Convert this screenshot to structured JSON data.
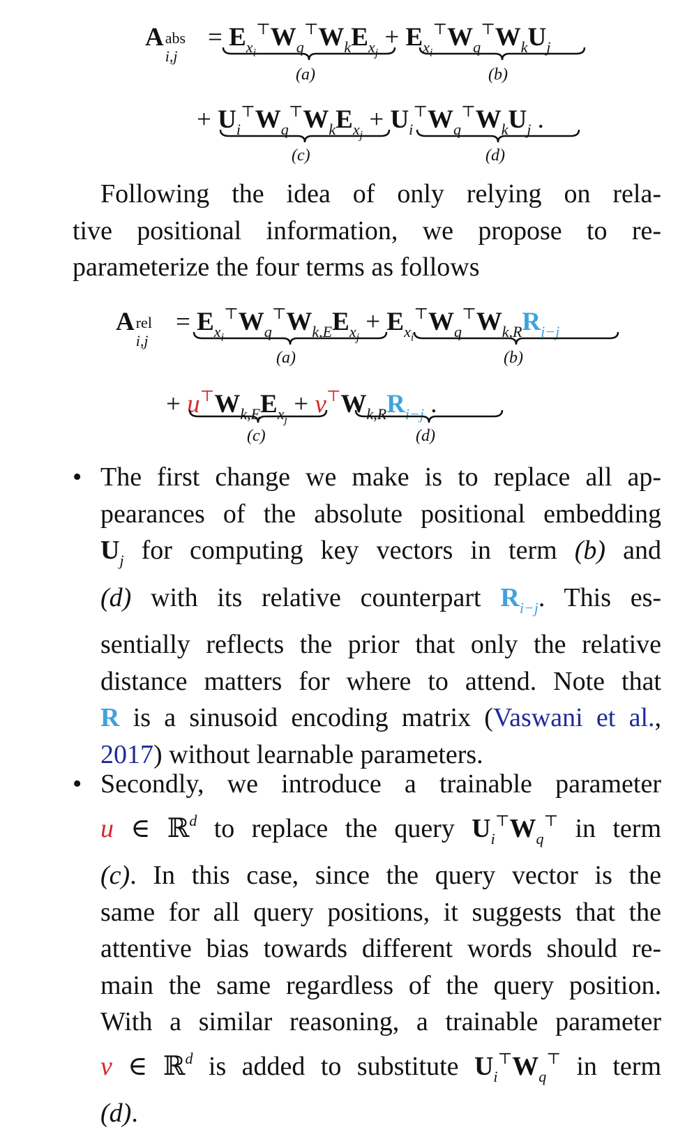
{
  "equation1": {
    "lhs": "A",
    "lhs_sup": "abs",
    "lhs_sub": "i,j",
    "labels": [
      "(a)",
      "(b)",
      "(c)",
      "(d)"
    ]
  },
  "paragraph1": {
    "lines": [
      "Following the idea of only relying on rela-",
      "tive positional information, we propose to re-",
      "parameterize the four terms as follows"
    ]
  },
  "equation2": {
    "lhs": "A",
    "lhs_sup": "rel",
    "lhs_sub": "i,j",
    "labels": [
      "(a)",
      "(b)",
      "(c)",
      "(d)"
    ]
  },
  "bullet1": {
    "lines": [
      "The first change we make is to replace all ap-",
      "pearances of the absolute positional embedding",
      "for computing key vectors in term",
      "with its relative counterpart",
      "sentially reflects the prior that only the relative",
      "distance matters for where to attend. Note that",
      "is a sinusoid encoding matrix (",
      "without learnable parameters."
    ],
    "citation_part1": "Vaswani et al.",
    "citation_part2": "2017",
    "this_es": ". This es-",
    "and": "and"
  },
  "bullet2": {
    "lines": [
      "Secondly, we introduce a trainable parameter",
      "to replace the query",
      "in term",
      "In this case, since the query vector is the",
      "same for all query positions, it suggests that the",
      "attentive bias towards different words should re-",
      "main the same regardless of the query position.",
      "With a similar reasoning, a trainable parameter",
      "is added to substitute",
      "in term"
    ]
  },
  "colors": {
    "relative_R": "#3fa3dc",
    "params_uv": "#d42b2b",
    "citation": "#1f2b96"
  }
}
